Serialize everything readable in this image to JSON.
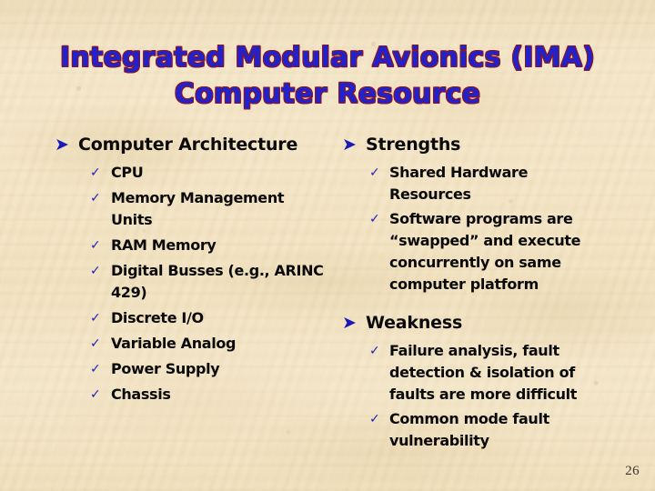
{
  "slide": {
    "title": "Integrated Modular Avionics (IMA)\nComputer Resource",
    "page_number": "26",
    "colors": {
      "title_fill": "#2222cc",
      "title_outline": "#8a1520",
      "bullet_blue": "#1919b8",
      "body_text": "#0a0a0a",
      "background": "#f2e3c4"
    },
    "icons": {
      "arrow_bullet": "➤",
      "check_bullet": "✓"
    }
  },
  "left_column": {
    "heading": "Computer Architecture",
    "items": [
      "CPU",
      "Memory Management Units",
      "RAM Memory",
      "Digital Busses (e.g., ARINC\n429)",
      "Discrete I/O",
      "Variable Analog",
      "Power Supply",
      "Chassis"
    ]
  },
  "right_column": {
    "strengths": {
      "heading": "Strengths",
      "items": [
        "Shared Hardware\nResources",
        "Software programs are\n“swapped” and execute\nconcurrently on same\ncomputer platform"
      ]
    },
    "weakness": {
      "heading": "Weakness",
      "items": [
        "Failure analysis, fault\ndetection & isolation of\nfaults are more difficult",
        "Common mode fault\nvulnerability"
      ]
    }
  }
}
